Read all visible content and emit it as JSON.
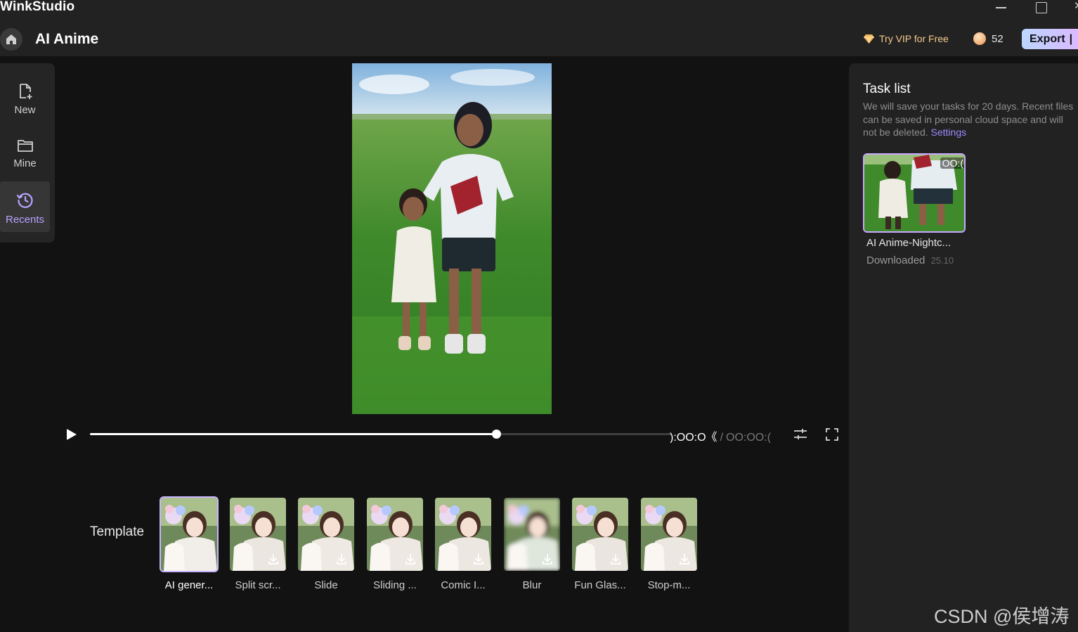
{
  "window": {
    "app_name": "WinkStudio"
  },
  "header": {
    "title": "AI Anime",
    "vip_label": "Try VIP for Free",
    "coin_count": "52",
    "export_label": "Export",
    "export_separator": "|"
  },
  "sidebar": {
    "items": [
      {
        "label": "New",
        "icon": "new-file-icon"
      },
      {
        "label": "Mine",
        "icon": "folder-icon"
      },
      {
        "label": "Recents",
        "icon": "history-icon",
        "active": true
      }
    ]
  },
  "player": {
    "current_time": "):OO:O《",
    "separator": "/",
    "total_time": "OO:OO:(",
    "progress": 0.698
  },
  "templates": {
    "label": "Template",
    "items": [
      {
        "name": "AI gener...",
        "selected": true,
        "downloadable": false
      },
      {
        "name": "Split scr...",
        "selected": false,
        "downloadable": true
      },
      {
        "name": "Slide",
        "selected": false,
        "downloadable": true
      },
      {
        "name": "Sliding ...",
        "selected": false,
        "downloadable": true
      },
      {
        "name": "Comic I...",
        "selected": false,
        "downloadable": true
      },
      {
        "name": "Blur",
        "selected": false,
        "downloadable": true
      },
      {
        "name": "Fun Glas...",
        "selected": false,
        "downloadable": true
      },
      {
        "name": "Stop-m...",
        "selected": false,
        "downloadable": true
      }
    ]
  },
  "task_panel": {
    "title": "Task list",
    "description": "We will save your tasks for 20 days. Recent files can be saved in personal cloud space and will not be deleted.",
    "settings_link": "Settings",
    "tasks": [
      {
        "name": "AI Anime-Nightc...",
        "status": "Downloaded",
        "date": "25.10",
        "duration": "OO:("
      }
    ]
  },
  "watermark": "CSDN @侯增涛",
  "colors": {
    "accent": "#b8a3ff",
    "vip": "#f5c98a",
    "export_gradient_start": "#bcd6ff",
    "export_gradient_end": "#e8b4ff",
    "background": "#121212",
    "panel": "#222222"
  }
}
